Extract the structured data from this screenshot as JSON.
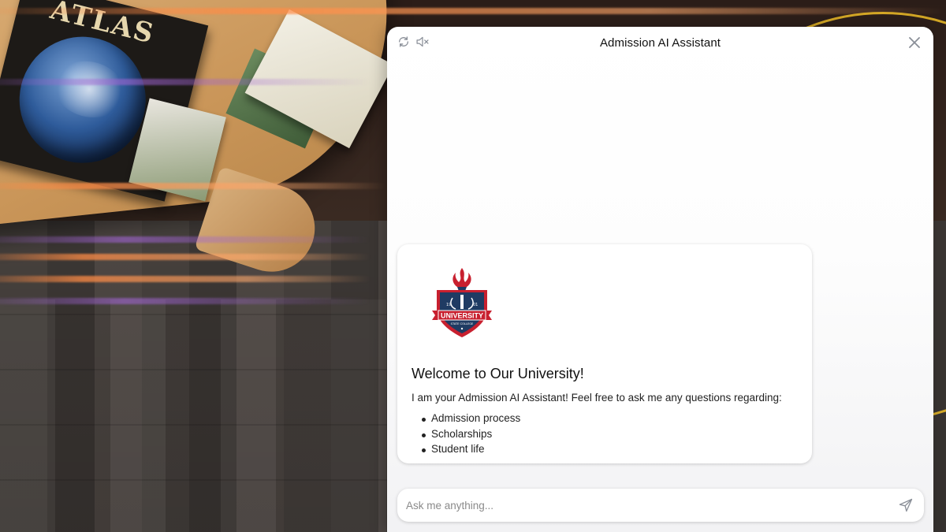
{
  "header": {
    "title": "Admission AI Assistant",
    "refresh_icon": "refresh-icon",
    "mute_icon": "speaker-muted-icon",
    "close_icon": "close-icon"
  },
  "background": {
    "book_title": "ATLAS"
  },
  "message": {
    "logo": {
      "label": "UNIVERSITY",
      "sub": "STATE COLLEGE",
      "year_left": "19",
      "year_right": "01"
    },
    "title": "Welcome to Our University!",
    "intro": "I am your Admission AI Assistant! Feel free to ask me any questions regarding:",
    "topics": [
      "Admission process",
      "Scholarships",
      "Student life"
    ]
  },
  "input": {
    "placeholder": "Ask me anything...",
    "send_icon": "send-icon"
  },
  "colors": {
    "accent_red": "#c8202f",
    "accent_navy": "#1f3b63",
    "arc_gold": "#f0be28"
  }
}
